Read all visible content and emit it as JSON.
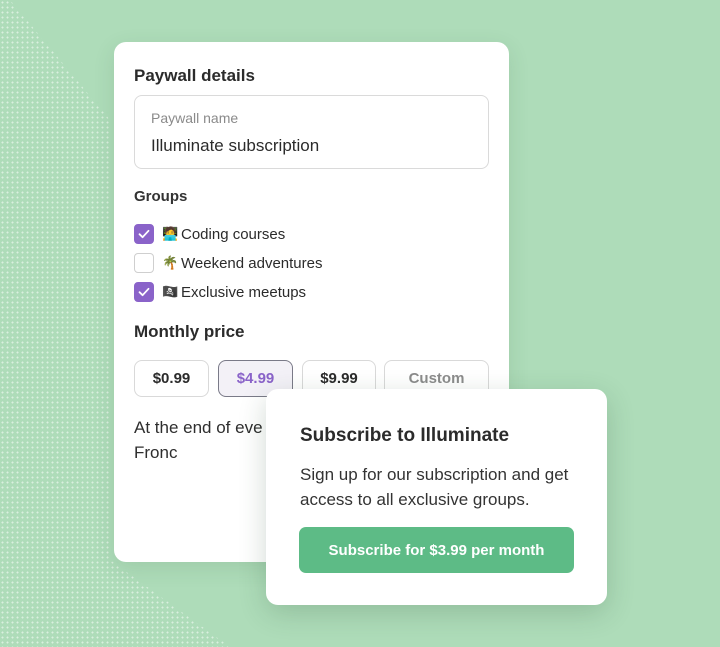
{
  "paywall": {
    "title": "Paywall details",
    "name_field": {
      "label": "Paywall name",
      "value": "Illuminate subscription"
    },
    "groups_title": "Groups",
    "groups": [
      {
        "emoji": "🧑‍💻",
        "label": "Coding courses",
        "checked": true
      },
      {
        "emoji": "🌴",
        "label": "Weekend adventures",
        "checked": false
      },
      {
        "emoji": "🏴‍☠️",
        "label": "Exclusive meetups",
        "checked": true
      }
    ],
    "price_title": "Monthly price",
    "prices": [
      {
        "label": "$0.99",
        "selected": false
      },
      {
        "label": "$4.99",
        "selected": true
      },
      {
        "label": "$9.99",
        "selected": false
      },
      {
        "label": "Custom",
        "selected": false
      }
    ],
    "description": "At the end of eve all subscription re Stripe + 3% Fronc"
  },
  "popup": {
    "title": "Subscribe to Illuminate",
    "body": "Sign up for our subscription and get access to all exclusive groups.",
    "button": "Subscribe for $3.99 per month"
  },
  "colors": {
    "background": "#aedcb9",
    "accent_purple": "#8a63c9",
    "button_green": "#5dbb86"
  }
}
